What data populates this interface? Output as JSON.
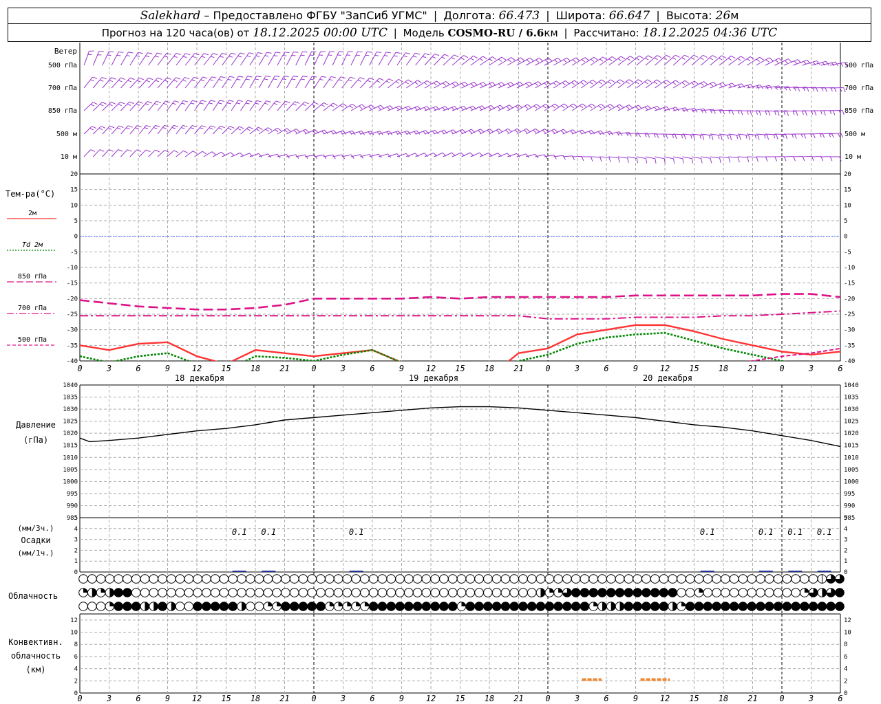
{
  "header": {
    "station": "Salekhard",
    "provider": "– Предоставлено ФГБУ \"ЗапСиб УГМС\"",
    "lon_label": "Долгота:",
    "lon": "66.473",
    "lat_label": "Широта:",
    "lat": "66.647",
    "alt_label": "Высота:",
    "alt": "26",
    "alt_unit": "м",
    "forecast_label": "Прогноз на 120 часа(ов) от",
    "forecast_start": "18.12.2025 00:00 UTC",
    "model_label": "Модель",
    "model": "COSMO-RU / 6.6",
    "model_unit": "км",
    "calc_label": "Рассчитано:",
    "calc_time": "18.12.2025 04:36 UTC"
  },
  "chart_data": {
    "type": "meteogram",
    "hour_ticks": [
      "0",
      "3",
      "6",
      "9",
      "12",
      "15",
      "18",
      "21",
      "0",
      "3",
      "6",
      "9",
      "12",
      "15",
      "18",
      "21",
      "0",
      "3",
      "6",
      "9",
      "12",
      "15",
      "18",
      "21",
      "0",
      "3",
      "6"
    ],
    "dates": [
      "18 декабря",
      "19 декабря",
      "20 декабря"
    ],
    "wind": {
      "title": "Ветер",
      "levels": [
        "500 гПа",
        "700 гПа",
        "850 гПа",
        "500 м",
        "10 м"
      ],
      "color": "#9933cc"
    },
    "temperature": {
      "title": "Тем-ра(°С)",
      "ylim": [
        -40,
        20
      ],
      "ticks": [
        "20",
        "15",
        "10",
        "5",
        "0",
        "-5",
        "-10",
        "-15",
        "-20",
        "-25",
        "-30",
        "-35",
        "-40"
      ],
      "legend": [
        {
          "label": "2м",
          "color": "#ff3333",
          "style": "solid"
        },
        {
          "label": "Td 2м",
          "color": "#008800",
          "style": "dotted"
        },
        {
          "label": "850 гПа",
          "color": "#dd1188",
          "style": "dash"
        },
        {
          "label": "700 гПа",
          "color": "#dd1188",
          "style": "dashdot"
        },
        {
          "label": "500 гПа",
          "color": "#dd1188",
          "style": "shortdash"
        }
      ],
      "series": [
        {
          "name": "2м",
          "x": [
            0,
            3,
            6,
            9,
            12,
            15,
            18,
            21,
            24,
            27,
            30,
            33,
            36,
            39,
            42,
            45,
            48,
            51,
            54,
            57,
            60,
            63,
            66,
            69,
            72,
            75,
            78
          ],
          "y": [
            -35,
            -36.5,
            -34.5,
            -34,
            -38.5,
            -41,
            -36.5,
            -37.5,
            -38.5,
            -37.5,
            -36.5,
            -40.5,
            -45,
            -46,
            -45,
            -37.5,
            -36,
            -31.5,
            -30,
            -28.5,
            -28.5,
            -30.5,
            -33,
            -35,
            -37,
            -38,
            -37
          ]
        },
        {
          "name": "Td 2м",
          "x": [
            0,
            3,
            6,
            9,
            12,
            15,
            18,
            21,
            24,
            27,
            30,
            33,
            36,
            39,
            42,
            45,
            48,
            51,
            54,
            57,
            60,
            63,
            66,
            69,
            72,
            75,
            78
          ],
          "y": [
            -38.5,
            -40.5,
            -38.5,
            -37.5,
            -41,
            -43,
            -38.5,
            -39,
            -40,
            -38,
            -36.5,
            -40.5,
            -46,
            -47,
            -46,
            -40,
            -38,
            -34.5,
            -32.5,
            -31.5,
            -31,
            -33.5,
            -36,
            -38,
            -40,
            -42,
            -42
          ]
        },
        {
          "name": "850 гПа",
          "x": [
            0,
            3,
            6,
            9,
            12,
            15,
            18,
            21,
            24,
            27,
            30,
            33,
            36,
            39,
            42,
            45,
            48,
            51,
            54,
            57,
            60,
            63,
            66,
            69,
            72,
            75,
            78
          ],
          "y": [
            -20.5,
            -21.5,
            -22.5,
            -23,
            -23.5,
            -23.5,
            -23,
            -22,
            -20,
            -20,
            -20,
            -20,
            -19.5,
            -20,
            -19.5,
            -19.5,
            -19.5,
            -19.5,
            -19.5,
            -19,
            -19,
            -19,
            -19,
            -19,
            -18.5,
            -18.5,
            -19.5
          ]
        },
        {
          "name": "700 гПа",
          "x": [
            0,
            3,
            6,
            9,
            12,
            15,
            18,
            21,
            24,
            27,
            30,
            33,
            36,
            39,
            42,
            45,
            48,
            51,
            54,
            57,
            60,
            63,
            66,
            69,
            72,
            75,
            78
          ],
          "y": [
            -25.5,
            -25.5,
            -25.5,
            -25.5,
            -25.5,
            -25.5,
            -25.5,
            -25.5,
            -25.5,
            -25.5,
            -25.5,
            -25.5,
            -25.5,
            -25.5,
            -25.5,
            -25.5,
            -26.5,
            -26.5,
            -26.5,
            -26,
            -26,
            -26,
            -25.5,
            -25.5,
            -25,
            -24.5,
            -24
          ]
        },
        {
          "name": "500 гПа",
          "x": [
            63,
            66,
            69,
            72,
            75,
            78
          ],
          "y": [
            -42,
            -41,
            -40,
            -38.5,
            -37.5,
            -36
          ]
        }
      ]
    },
    "pressure": {
      "title": "Давление",
      "unit": "(гПа)",
      "ylim": [
        985,
        1040
      ],
      "ticks": [
        "1040",
        "1035",
        "1030",
        "1025",
        "1020",
        "1015",
        "1010",
        "1005",
        "1000",
        "995",
        "990",
        "985"
      ],
      "series": [
        {
          "name": "",
          "x": [
            0,
            1,
            3,
            6,
            9,
            12,
            15,
            18,
            21,
            24,
            27,
            30,
            33,
            36,
            39,
            42,
            45,
            48,
            51,
            54,
            57,
            60,
            63,
            66,
            69,
            72,
            75,
            78
          ],
          "y": [
            1018,
            1016.5,
            1017,
            1018,
            1019.5,
            1021,
            1022,
            1023.5,
            1025.5,
            1026.5,
            1027.5,
            1028.5,
            1029.5,
            1030.5,
            1031,
            1031,
            1030.5,
            1029.5,
            1028.5,
            1027.5,
            1026.5,
            1025,
            1023.5,
            1022.5,
            1021,
            1019,
            1017,
            1014.5
          ]
        }
      ]
    },
    "precipitation": {
      "title_top": "(мм/3ч.)",
      "title_mid": "Осадки",
      "title_bot": "(мм/1ч.)",
      "ylim": [
        0,
        5
      ],
      "ticks": [
        "5",
        "4",
        "3",
        "2",
        "1",
        "0"
      ],
      "labels": [
        {
          "x": 16.5,
          "text": "0.1"
        },
        {
          "x": 19.5,
          "text": "0.1"
        },
        {
          "x": 28.5,
          "text": "0.1"
        },
        {
          "x": 64.5,
          "text": "0.1"
        },
        {
          "x": 70.5,
          "text": "0.1"
        },
        {
          "x": 73.5,
          "text": "0.1"
        },
        {
          "x": 76.5,
          "text": "0.1"
        }
      ]
    },
    "cloud": {
      "title": "Облачность",
      "rows": [
        "ooooooooooooooooooooooooooooooooooooooooooooooooooooooooooooooooooooooooooooooooooooooooooooooooooooooooooooooooooooooooooooooohlmfsf",
        "qhqqhmffoooooooooooooooooooooooooooooooooooooooooooooooooooooooooooooooooooooooohhqmqmmfffffffffffffffffffoohqooooooooooooooooooqmhhmfff",
        "ooooqffffffhhffhhoooffffffffhhoooqqqffffffffqqqqqqqqffffffffffffffffqffffffffffffffffffffffqqhhhhhffffffffhqffffffffffffffffffffffffffffff"
      ]
    },
    "convective": {
      "title_top": "Конвективн.",
      "title_mid": "облачность",
      "title_bot": "(км)",
      "ylim": [
        0,
        13
      ],
      "ticks": [
        "12",
        "10",
        "8",
        "6",
        "4",
        "2",
        "0"
      ],
      "segments": [
        {
          "x0": 51.5,
          "x1": 53.5,
          "y": 2.2
        },
        {
          "x0": 57.5,
          "x1": 60.5,
          "y": 2.2
        }
      ],
      "color": "#ee8833"
    }
  }
}
